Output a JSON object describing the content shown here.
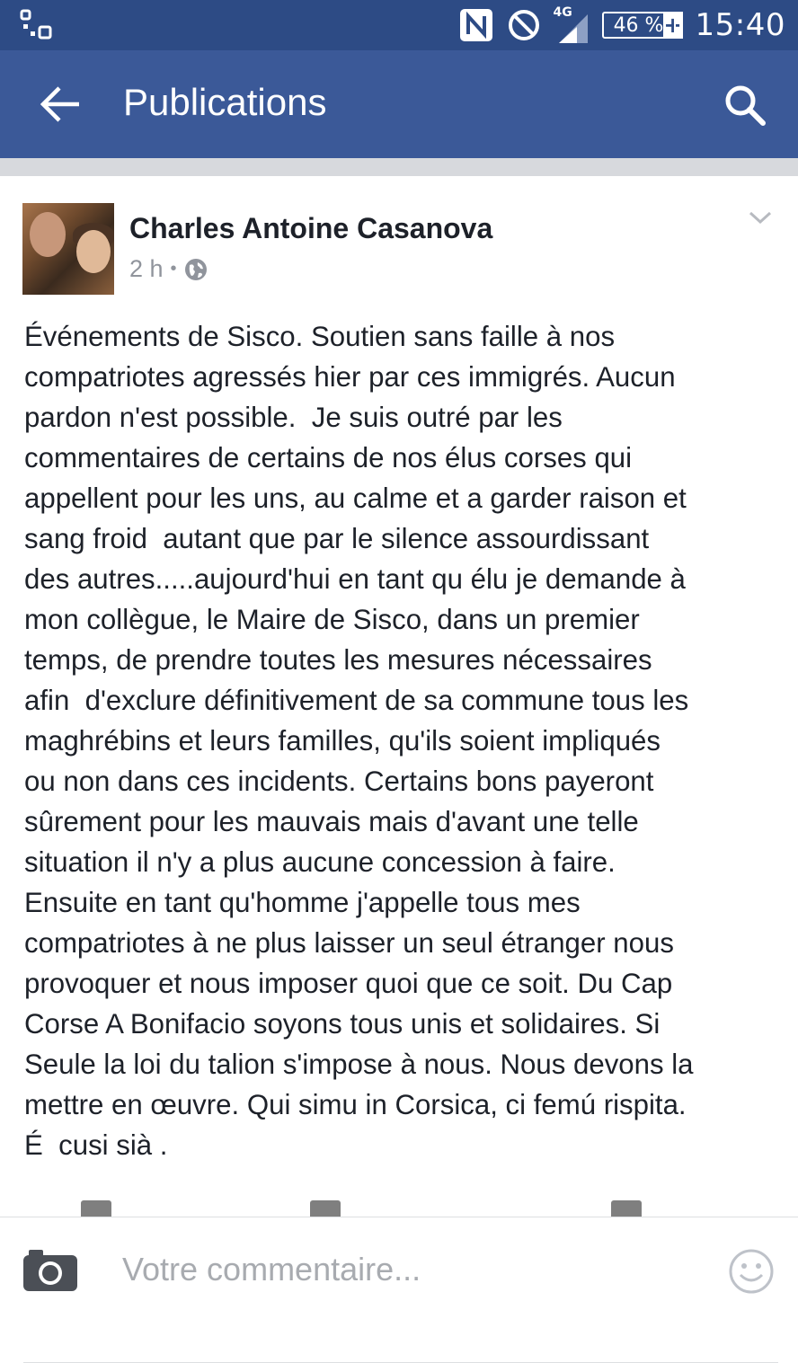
{
  "status_bar": {
    "time": "15:40",
    "battery": "46 %",
    "battery_charging_symbol": "+",
    "network_type": "4G",
    "icons": [
      "notification-icon",
      "nfc-icon",
      "do-not-disturb-icon",
      "signal-icon",
      "battery-icon"
    ]
  },
  "app_bar": {
    "title": "Publications",
    "back_icon": "arrow-left-icon",
    "search_icon": "search-icon"
  },
  "post": {
    "author": "Charles Antoine Casanova",
    "time": "2 h",
    "separator": "•",
    "privacy_icon": "globe-icon",
    "menu_icon": "chevron-down-icon",
    "text": "Événements de Sisco. Soutien sans faille à nos\ncompatriotes agressés hier par ces immigrés. Aucun\npardon n'est possible.  Je suis outré par les\ncommentaires de certains de nos élus corses qui\nappellent pour les uns, au calme et a garder raison et\nsang froid  autant que par le silence assourdissant\ndes autres.....aujourd'hui en tant qu élu je demande à\nmon collègue, le Maire de Sisco, dans un premier\ntemps, de prendre toutes les mesures nécessaires\nafin  d'exclure définitivement de sa commune tous les\nmaghrébins et leurs familles, qu'ils soient impliqués\nou non dans ces incidents. Certains bons payeront\nsûrement pour les mauvais mais d'avant une telle\nsituation il n'y a plus aucune concession à faire.\nEnsuite en tant qu'homme j'appelle tous mes\ncompatriotes à ne plus laisser un seul étranger nous\nprovoquer et nous imposer quoi que ce soit. Du Cap\nCorse A Bonifacio soyons tous unis et solidaires. Si\nSeule la loi du talion s'impose à nous. Nous devons la\nmettre en œuvre. Qui simu in Corsica, ci femú rispita.\nÉ  cusi sià ."
  },
  "comment_bar": {
    "placeholder": "Votre commentaire...",
    "camera_icon": "camera-icon",
    "emoji_icon": "smiley-icon"
  },
  "colors": {
    "status_bar": "#2d4b85",
    "app_bar": "#3b5998",
    "text": "#1d2129",
    "meta": "#90949c"
  }
}
